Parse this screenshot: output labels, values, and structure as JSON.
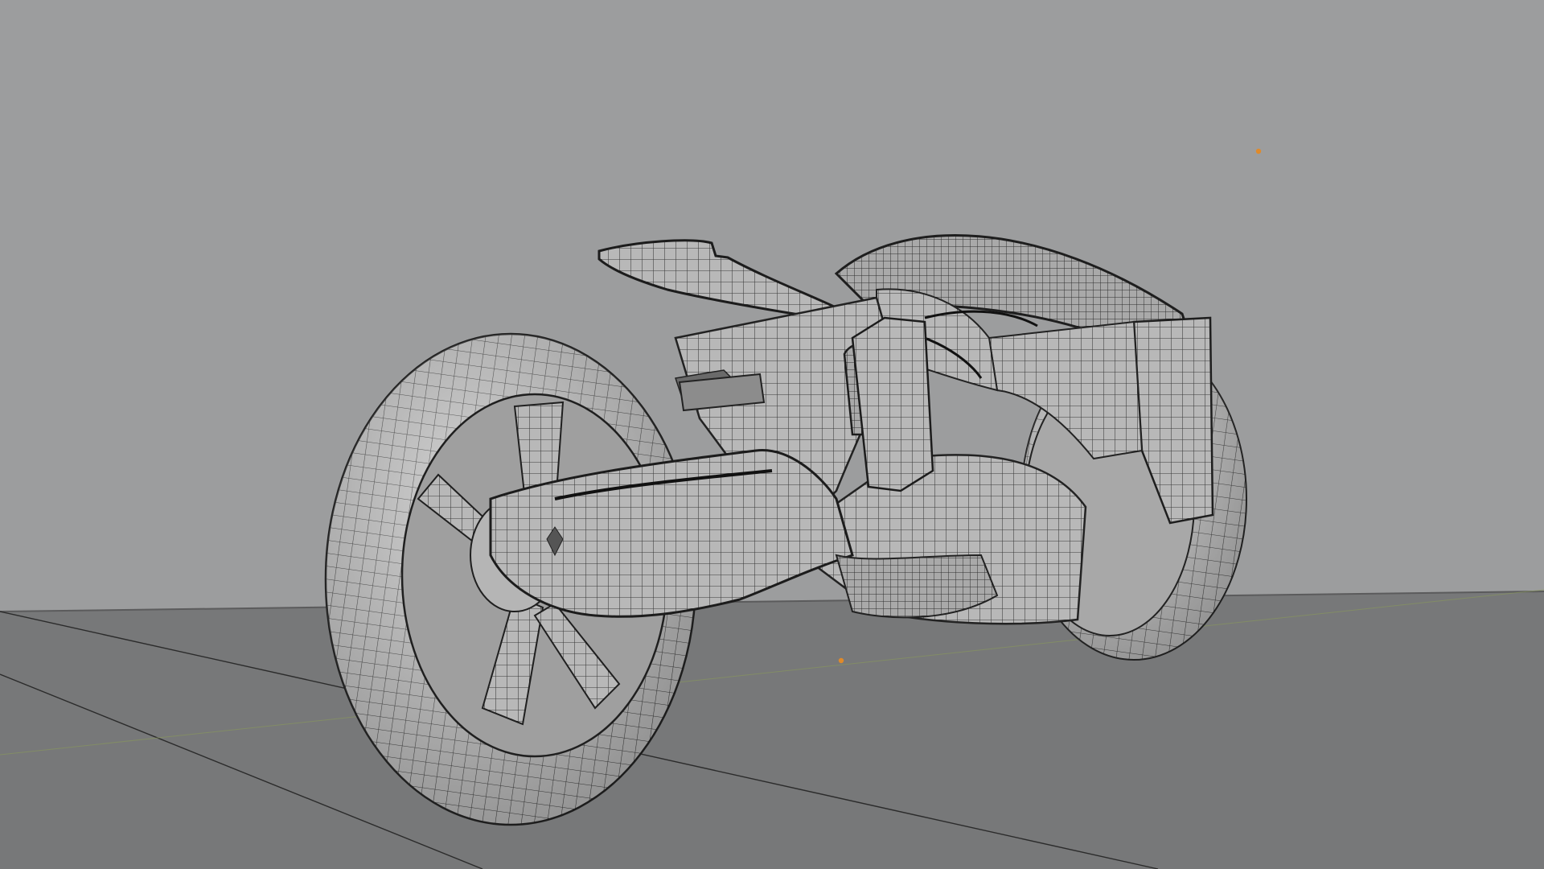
{
  "viewport": {
    "mode": "wireframe-overlay-solid",
    "subject": "motorcycle-model"
  },
  "colors": {
    "background": "#9c9d9e",
    "floor": "#777879",
    "mesh_fill": "#b9b9b9",
    "mesh_shadow": "#8a8a8a",
    "wire": "#2a2a2a",
    "origin_point": "#e08a2a"
  },
  "objects": [
    {
      "name": "rear-wheel"
    },
    {
      "name": "front-wheel"
    },
    {
      "name": "body-frame"
    },
    {
      "name": "seat"
    },
    {
      "name": "fairing"
    },
    {
      "name": "light-origin"
    },
    {
      "name": "object-origin"
    }
  ]
}
